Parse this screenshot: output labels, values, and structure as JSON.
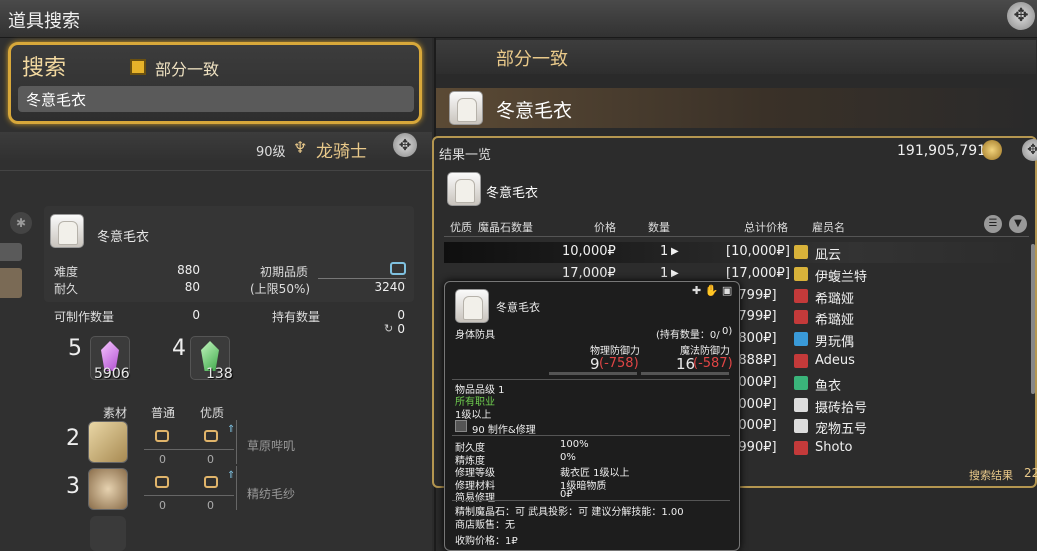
{
  "window": {
    "title": "道具搜索"
  },
  "search": {
    "heading": "搜索",
    "checkbox_label": "部分一致",
    "query": "冬意毛衣"
  },
  "right_header": {
    "title": "部分一致",
    "item_name": "冬意毛衣"
  },
  "character": {
    "level": "90级",
    "job": "龙骑士"
  },
  "craft": {
    "item_name": "冬意毛衣",
    "difficulty_label": "难度",
    "difficulty": "880",
    "durability_label": "耐久",
    "durability": "80",
    "initial_quality_label": "初期品质",
    "limit_label": "(上限50%)",
    "limit": "3240",
    "craftable_label": "可制作数量",
    "craftable": "0",
    "owned_label": "持有数量",
    "owned": "0",
    "owned_sub": "0",
    "crystals": [
      {
        "need": "5",
        "have": "5906"
      },
      {
        "need": "4",
        "have": "138"
      }
    ],
    "mat_headers": {
      "material": "素材",
      "normal": "普通",
      "hq": "优质"
    },
    "materials": [
      {
        "need": "2",
        "name": "草原哔叽",
        "normal": "0",
        "hq": "0"
      },
      {
        "need": "3",
        "name": "精纺毛纱",
        "normal": "0",
        "hq": "0"
      }
    ]
  },
  "results": {
    "title": "结果一览",
    "gil": "191,905,791",
    "item_name": "冬意毛衣",
    "columns": {
      "hq": "优质",
      "materia": "魔晶石数量",
      "price": "价格",
      "qty": "数量",
      "total": "总计价格",
      "retainer": "雇员名"
    },
    "rows": [
      {
        "price": "10,000₽",
        "qty": "1",
        "total": "[10,000₽]",
        "retainer": "凪云",
        "badge": "#d8b23a"
      },
      {
        "price": "17,000₽",
        "qty": "1",
        "total": "[17,000₽]",
        "retainer": "伊蝮兰特",
        "badge": "#d8b23a"
      },
      {
        "price": "",
        "qty": "",
        "total": "7,799₽]",
        "retainer": "希璐娅",
        "badge": "#c43a3a"
      },
      {
        "price": "",
        "qty": "",
        "total": "7,799₽]",
        "retainer": "希璐娅",
        "badge": "#c43a3a"
      },
      {
        "price": "",
        "qty": "",
        "total": "7,800₽]",
        "retainer": "男玩偶",
        "badge": "#3a9ad8"
      },
      {
        "price": "",
        "qty": "",
        "total": "7,888₽]",
        "retainer": "Adeus",
        "badge": "#c43a3a"
      },
      {
        "price": "",
        "qty": "",
        "total": "8,000₽]",
        "retainer": "鱼衣",
        "badge": "#3ab47a"
      },
      {
        "price": "",
        "qty": "",
        "total": "8,000₽]",
        "retainer": "摄砖拾号",
        "badge": "#dddddd"
      },
      {
        "price": "",
        "qty": "",
        "total": "8,000₽]",
        "retainer": "宠物五号",
        "badge": "#dddddd"
      },
      {
        "price": "",
        "qty": "",
        "total": "9,990₽]",
        "retainer": "Shoto",
        "badge": "#c43a3a"
      }
    ],
    "footer": "搜索结果",
    "footer_count": "22"
  },
  "tooltip": {
    "name": "冬意毛衣",
    "category": "身体防具",
    "owned": "(持有数量：0/",
    "owned_hq": "0)",
    "phys_label": "物理防御力",
    "phys": "9",
    "phys_diff": "(-758)",
    "mag_label": "魔法防御力",
    "mag": "16",
    "mag_diff": "(-587)",
    "item_level": "物品品级 1",
    "classes": "所有职业",
    "level_req": "1级以上",
    "repair_line": "90 制作&修理",
    "stats": [
      {
        "label": "耐久度",
        "value": "100%"
      },
      {
        "label": "精炼度",
        "value": "0%"
      },
      {
        "label": "修理等级",
        "value": "裁衣匠 1级以上"
      },
      {
        "label": "修理材料",
        "value": "1级暗物质"
      },
      {
        "label": "简易修理",
        "value": "0₽"
      }
    ],
    "misc1": "精制魔晶石：可    武具投影：可    建议分解技能：1.00",
    "misc2": "商店贩售：无",
    "misc3": "收购价格：1₽"
  }
}
